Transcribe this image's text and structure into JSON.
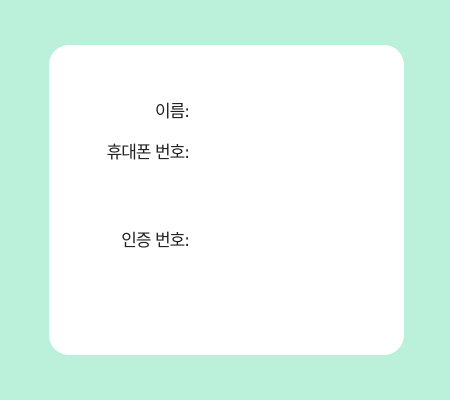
{
  "form": {
    "name": {
      "label": "이름:",
      "value": ""
    },
    "phone": {
      "label": "휴대폰 번호:",
      "value": ""
    },
    "verification_code": {
      "label": "인증 번호:",
      "value": ""
    }
  },
  "colors": {
    "background": "#bbf1da",
    "card": "#ffffff",
    "text": "#222222"
  }
}
